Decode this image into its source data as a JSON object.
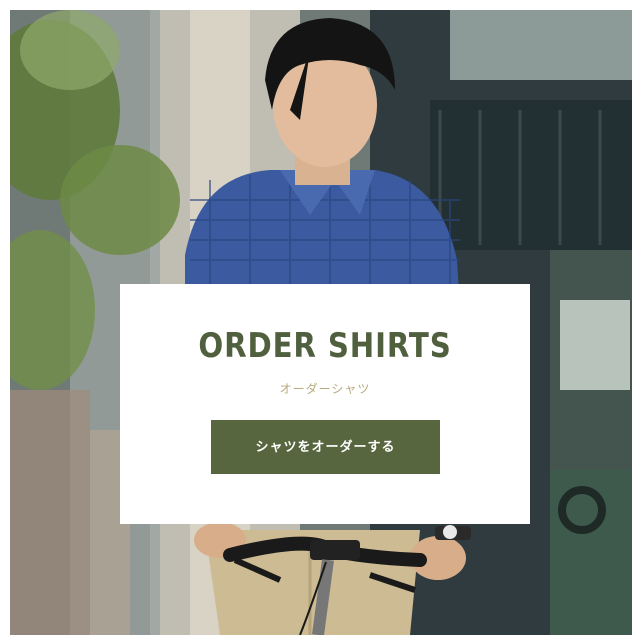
{
  "banner": {
    "title": "ORDER SHIRTS",
    "subtitle": "オーダーシャツ",
    "cta_label": "シャツをオーダーする"
  },
  "colors": {
    "title": "#50603f",
    "subtitle": "#b8aa7c",
    "button": "#57663f",
    "panel": "#ffffff"
  }
}
